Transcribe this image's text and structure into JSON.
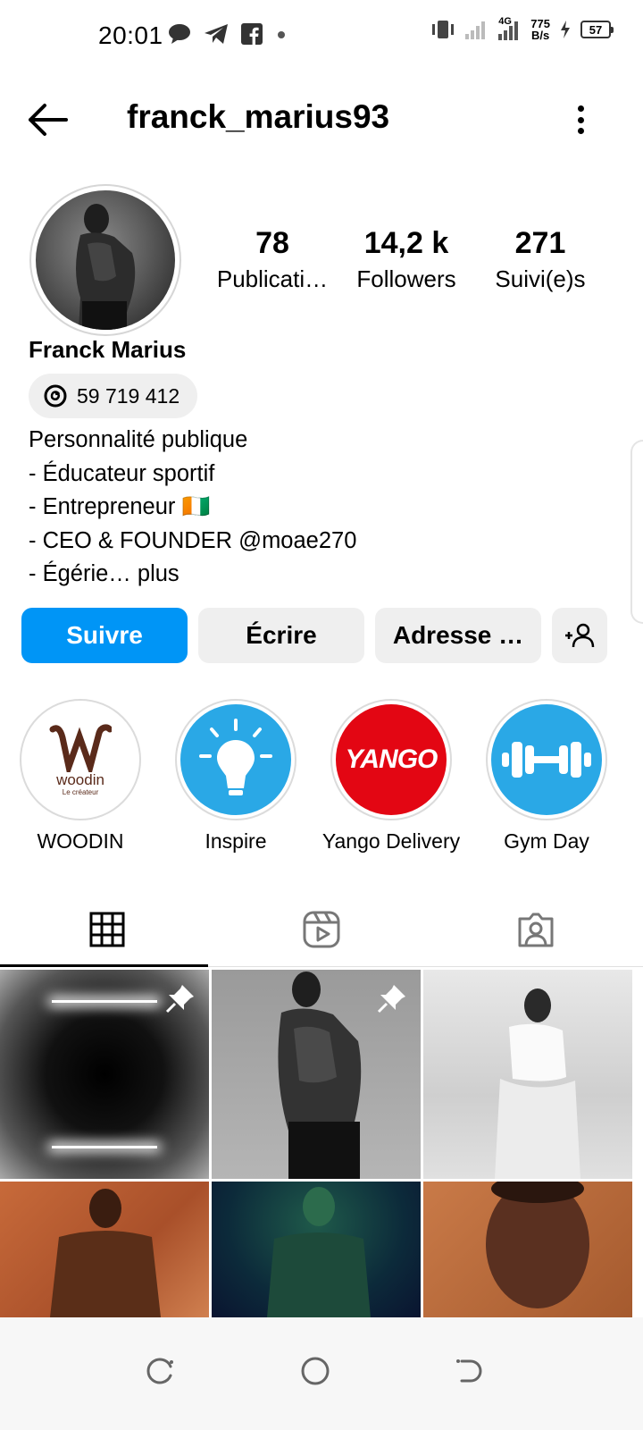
{
  "status_bar": {
    "time": "20:01",
    "net_speed_value": "775",
    "net_speed_unit": "B/s",
    "network": "4G",
    "battery": "57"
  },
  "header": {
    "username": "franck_marius93"
  },
  "profile": {
    "stats": [
      {
        "value": "78",
        "label": "Publicati…"
      },
      {
        "value": "14,2 k",
        "label": "Followers"
      },
      {
        "value": "271",
        "label": "Suivi(e)s"
      }
    ],
    "full_name": "Franck Marius",
    "threads_count": "59 719 412",
    "bio_lines": [
      "Personnalité publique",
      "- Éducateur sportif",
      "- Entrepreneur 🇨🇮",
      "- CEO & FOUNDER @moae270"
    ],
    "bio_last_line": "- Égérie…",
    "bio_more": "plus"
  },
  "actions": {
    "follow": "Suivre",
    "message": "Écrire",
    "address": "Adresse …"
  },
  "highlights": [
    {
      "label": "WOODIN",
      "logo_text": "woodin",
      "logo_sub": "Le créateur"
    },
    {
      "label": "Inspire"
    },
    {
      "label": "Yango Delivery",
      "logo_text": "YANGO"
    },
    {
      "label": "Gym Day"
    }
  ],
  "colors": {
    "accent": "#0095f6",
    "button_bg": "#efefef",
    "yango_red": "#e30613",
    "highlight_blue": "#2aa8e6",
    "woodin_brown": "#5a2a1a"
  }
}
